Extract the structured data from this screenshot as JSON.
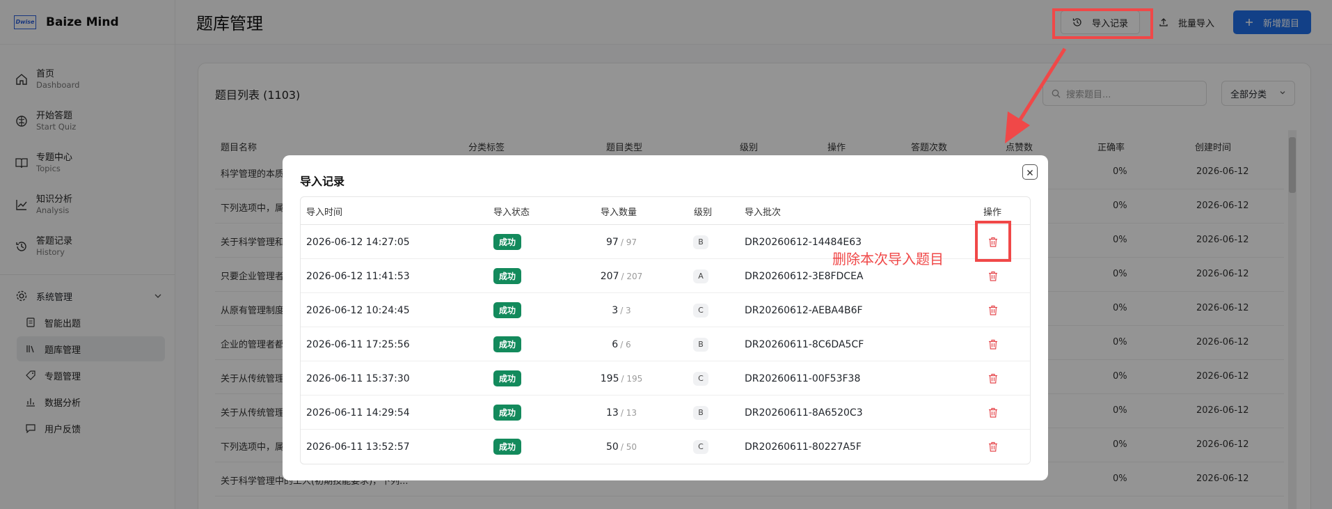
{
  "brand": {
    "logo_text": "Dwise",
    "name": "Baize Mind"
  },
  "sidebar": {
    "items": [
      {
        "zh": "首页",
        "en": "Dashboard",
        "icon": "home-icon"
      },
      {
        "zh": "开始答题",
        "en": "Start Quiz",
        "icon": "brain-icon"
      },
      {
        "zh": "专题中心",
        "en": "Topics",
        "icon": "book-icon"
      },
      {
        "zh": "知识分析",
        "en": "Analysis",
        "icon": "chart-line-icon"
      },
      {
        "zh": "答题记录",
        "en": "History",
        "icon": "history-icon"
      }
    ],
    "system": {
      "label": "系统管理",
      "children": [
        {
          "label": "智能出题",
          "icon": "document-icon"
        },
        {
          "label": "题库管理",
          "icon": "library-icon",
          "active": true
        },
        {
          "label": "专题管理",
          "icon": "tag-icon"
        },
        {
          "label": "数据分析",
          "icon": "bar-chart-icon"
        },
        {
          "label": "用户反馈",
          "icon": "message-icon"
        }
      ]
    }
  },
  "header": {
    "title": "题库管理",
    "import_record_label": "导入记录",
    "batch_import_label": "批量导入",
    "add_question_label": "新增题目"
  },
  "list": {
    "title": "题目列表 (1103)",
    "search_placeholder": "搜索题目...",
    "filter_label": "全部分类",
    "columns": [
      "题目名称",
      "分类标签",
      "题目类型",
      "级别",
      "操作",
      "答题次数",
      "点赞数",
      "正确率",
      "创建时间"
    ],
    "rows": [
      {
        "name": "科学管理的本质",
        "rate": "0%",
        "date": "2026-06-12"
      },
      {
        "name": "下列选项中，属",
        "rate": "0%",
        "date": "2026-06-12"
      },
      {
        "name": "关于科学管理和",
        "rate": "0%",
        "date": "2026-06-12"
      },
      {
        "name": "只要企业管理者",
        "rate": "0%",
        "date": "2026-06-12"
      },
      {
        "name": "从原有管理制度",
        "rate": "0%",
        "date": "2026-06-12"
      },
      {
        "name": "企业的管理者都",
        "rate": "0%",
        "date": "2026-06-12"
      },
      {
        "name": "关于从传统管理",
        "rate": "0%",
        "date": "2026-06-12"
      },
      {
        "name": "关于从传统管理",
        "rate": "0%",
        "date": "2026-06-12"
      },
      {
        "name": "下列选项中，属",
        "rate": "0%",
        "date": "2026-06-12"
      },
      {
        "name": "关于科学管理中的工人(初期技能要求)，下列...",
        "rate": "0%",
        "date": "2026-06-12"
      }
    ]
  },
  "modal": {
    "title": "导入记录",
    "columns": [
      "导入时间",
      "导入状态",
      "导入数量",
      "级别",
      "导入批次",
      "操作"
    ],
    "rows": [
      {
        "time": "2026-06-12 14:27:05",
        "status": "成功",
        "count": "97",
        "total": "/ 97",
        "level": "B",
        "batch": "DR20260612-14484E63"
      },
      {
        "time": "2026-06-12 11:41:53",
        "status": "成功",
        "count": "207",
        "total": "/ 207",
        "level": "A",
        "batch": "DR20260612-3E8FDCEA"
      },
      {
        "time": "2026-06-12 10:24:45",
        "status": "成功",
        "count": "3",
        "total": "/ 3",
        "level": "C",
        "batch": "DR20260612-AEBA4B6F"
      },
      {
        "time": "2026-06-11 17:25:56",
        "status": "成功",
        "count": "6",
        "total": "/ 6",
        "level": "B",
        "batch": "DR20260611-8C6DA5CF"
      },
      {
        "time": "2026-06-11 15:37:30",
        "status": "成功",
        "count": "195",
        "total": "/ 195",
        "level": "C",
        "batch": "DR20260611-00F53F38"
      },
      {
        "time": "2026-06-11 14:29:54",
        "status": "成功",
        "count": "13",
        "total": "/ 13",
        "level": "B",
        "batch": "DR20260611-8A6520C3"
      },
      {
        "time": "2026-06-11 13:52:57",
        "status": "成功",
        "count": "50",
        "total": "/ 50",
        "level": "C",
        "batch": "DR20260611-80227A5F"
      }
    ]
  },
  "annotation": {
    "text": "删除本次导入题目",
    "color": "#f04848"
  },
  "colors": {
    "primary": "#1f6ee8",
    "success": "#138a5c",
    "danger": "#e5484d"
  }
}
